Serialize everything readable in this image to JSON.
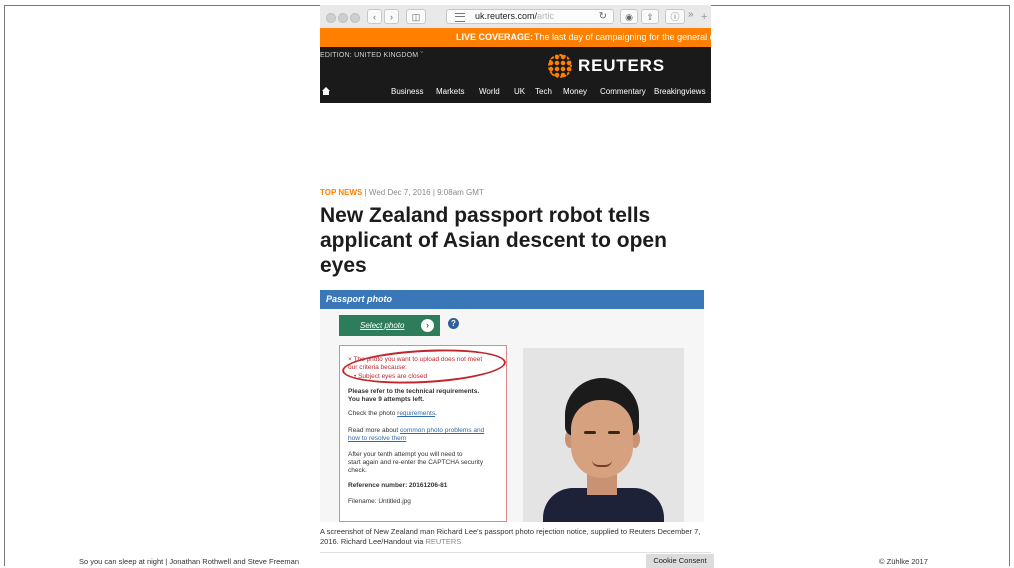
{
  "browser": {
    "url_visible": "uk.reuters.com/",
    "url_faded": "artic",
    "overflow": "»",
    "new_tab": "+"
  },
  "reuters": {
    "banner_label": "LIVE COVERAGE:",
    "banner_text": "The last day of campaigning for the general election",
    "edition": "EDITION: UNITED KINGDOM",
    "logo_text": "REUTERS",
    "nav": [
      "Business",
      "Markets",
      "World",
      "UK",
      "Tech",
      "Money",
      "Commentary",
      "Breakingviews"
    ]
  },
  "article": {
    "kicker": "TOP NEWS",
    "date": "| Wed Dec 7, 2016 | 9:08am GMT",
    "headline": "New Zealand passport robot tells applicant of Asian descent to open eyes",
    "caption": "A screenshot of New Zealand man Richard Lee's passport photo rejection notice, supplied to Reuters December 7, 2016. Richard Lee/Handout via",
    "caption_via": "REUTERS"
  },
  "passport": {
    "title": "Passport photo",
    "select_label": "Select photo",
    "help": "?",
    "errors": {
      "line1": "× The photo you want to upload does not meet",
      "line2": "our criteria because:",
      "line3": "•  Subject eyes are closed",
      "line4": "Please refer to the technical requirements.",
      "line5": "You have 9 attempts left.",
      "line6_pre": "Check the photo",
      "line6_link": "requirements",
      "line7_pre": "Read more about",
      "line7_link": "common photo problems and",
      "line8_link": "how to resolve them",
      "line9": "After your tenth attempt you will need to",
      "line10": "start again and re-enter the CAPTCHA security",
      "line11": "check.",
      "line12": "Reference number: 20161206-81",
      "line13": "Filename: Untitled.jpg"
    }
  },
  "cookie": {
    "label": "Cookie Consent"
  },
  "footer": {
    "left": "So you can sleep at night | Jonathan Rothwell and Steve Freeman",
    "right": "© Zühlke 2017"
  },
  "colors": {
    "reuters_orange": "#ff8000",
    "header_dark": "#1a1a1a",
    "passport_blue": "#3a77b8",
    "select_green": "#2e7d5a",
    "error_red": "#c0272d"
  }
}
